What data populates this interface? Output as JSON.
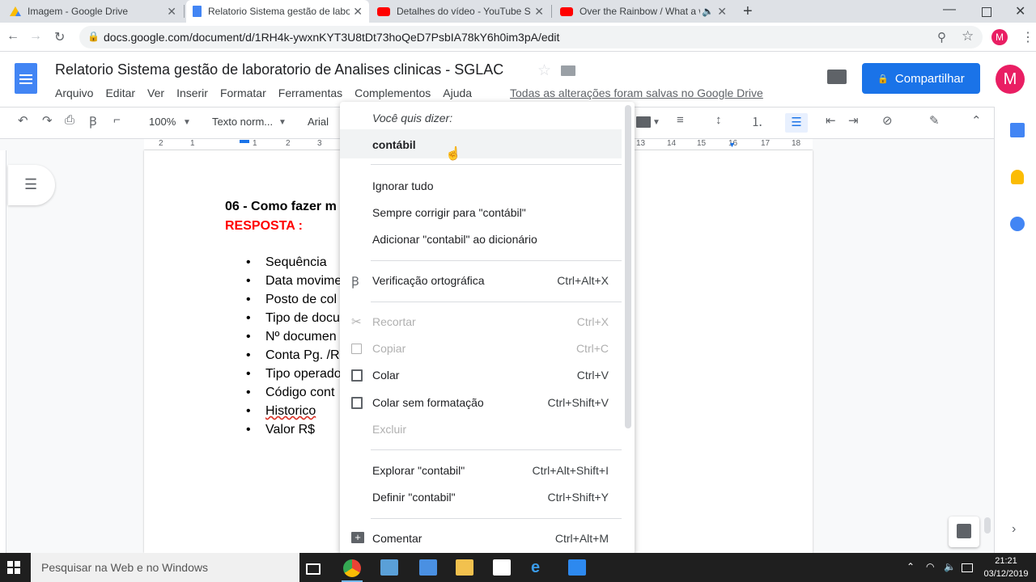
{
  "browser": {
    "tabs": [
      {
        "title": "Imagem - Google Drive",
        "icon": "drive-icon"
      },
      {
        "title": "Relatorio Sistema gestão de labo",
        "icon": "docs-icon"
      },
      {
        "title": "Detalhes do vídeo - YouTube Stu",
        "icon": "youtube-icon"
      },
      {
        "title": "Over the Rainbow / What a w",
        "icon": "youtube-icon"
      }
    ],
    "url": "docs.google.com/document/d/1RH4k-ywxnKYT3U8tDt73hoQeD7PsbIA78kY6h0im3pA/edit",
    "profile_initial": "M"
  },
  "docs": {
    "title": "Relatorio Sistema gestão de laboratorio de Analises clinicas - SGLAC",
    "menu": [
      "Arquivo",
      "Editar",
      "Ver",
      "Inserir",
      "Formatar",
      "Ferramentas",
      "Complementos",
      "Ajuda"
    ],
    "saved_status": "Todas as alterações foram salvas no Google Drive",
    "share_label": "Compartilhar",
    "user_initial": "M",
    "zoom": "100%",
    "style": "Texto norm...",
    "font": "Arial",
    "ruler_left": [
      "2",
      "1",
      "1",
      "2",
      "3"
    ],
    "ruler_right": [
      "13",
      "14",
      "15",
      "16",
      "17",
      "18"
    ]
  },
  "document": {
    "question": "06 - Como fazer m",
    "answer_label": "RESPOSTA :",
    "bullets": [
      "Sequência",
      "Data movime",
      "Posto de col",
      "Tipo de docu",
      "Nº documen",
      "Conta Pg. /R",
      "Tipo operado",
      "Código cont",
      "Historico",
      "Valor R$"
    ]
  },
  "context_menu": {
    "suggestion_header": "Você quis dizer:",
    "suggestion": "contábil",
    "ignore_all": "Ignorar tudo",
    "always_correct": "Sempre corrigir para \"contábil\"",
    "add_dict": "Adicionar \"contabil\" ao dicionário",
    "spellcheck": "Verificação ortográfica",
    "spellcheck_sc": "Ctrl+Alt+X",
    "cut": "Recortar",
    "cut_sc": "Ctrl+X",
    "copy": "Copiar",
    "copy_sc": "Ctrl+C",
    "paste": "Colar",
    "paste_sc": "Ctrl+V",
    "paste_plain": "Colar sem formatação",
    "paste_plain_sc": "Ctrl+Shift+V",
    "delete": "Excluir",
    "explore": "Explorar \"contabil\"",
    "explore_sc": "Ctrl+Alt+Shift+I",
    "define": "Definir \"contabil\"",
    "define_sc": "Ctrl+Shift+Y",
    "comment": "Comentar",
    "comment_sc": "Ctrl+Alt+M"
  },
  "taskbar": {
    "search_placeholder": "Pesquisar na Web e no Windows",
    "time": "21:21",
    "date": "03/12/2019"
  },
  "colors": {
    "accent": "#1a73e8",
    "answer_red": "#ff0000",
    "avatar_pink": "#e91e63"
  }
}
